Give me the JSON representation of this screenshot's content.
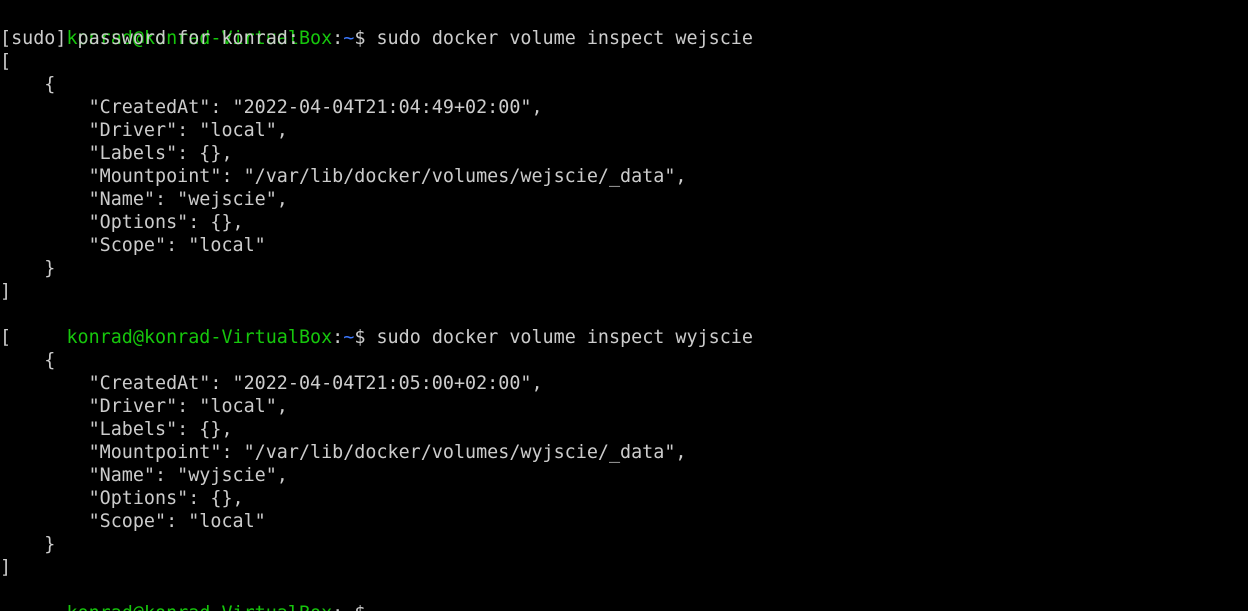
{
  "colors": {
    "background": "#000000",
    "text": "#cccccc",
    "prompt_user": "#16c60c",
    "prompt_path": "#3b78ff"
  },
  "prompt": {
    "user_host": "konrad@konrad-VirtualBox",
    "colon": ":",
    "path": "~",
    "symbol": "$"
  },
  "session": {
    "cmd1": " sudo docker volume inspect wejscie",
    "sudo_prompt": "[sudo] password for konrad:",
    "out1": [
      "[",
      "    {",
      "        \"CreatedAt\": \"2022-04-04T21:04:49+02:00\",",
      "        \"Driver\": \"local\",",
      "        \"Labels\": {},",
      "        \"Mountpoint\": \"/var/lib/docker/volumes/wejscie/_data\",",
      "        \"Name\": \"wejscie\",",
      "        \"Options\": {},",
      "        \"Scope\": \"local\"",
      "    }",
      "]"
    ],
    "cmd2": " sudo docker volume inspect wyjscie",
    "out2": [
      "[",
      "    {",
      "        \"CreatedAt\": \"2022-04-04T21:05:00+02:00\",",
      "        \"Driver\": \"local\",",
      "        \"Labels\": {},",
      "        \"Mountpoint\": \"/var/lib/docker/volumes/wyjscie/_data\",",
      "        \"Name\": \"wyjscie\",",
      "        \"Options\": {},",
      "        \"Scope\": \"local\"",
      "    }",
      "]"
    ],
    "cmd3": ""
  }
}
